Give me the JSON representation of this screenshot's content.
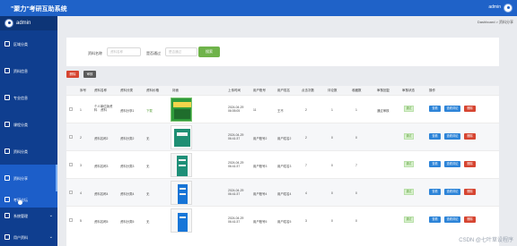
{
  "app": {
    "title": "\"聚力\"考研互助系统",
    "username": "admin"
  },
  "sidebar": {
    "profile_name": "admin",
    "items": [
      {
        "label": "区域分类",
        "icon": "grid-icon"
      },
      {
        "label": "资料信息",
        "icon": "book-icon"
      },
      {
        "label": "专业信息",
        "icon": "list-icon"
      },
      {
        "label": "课程分类",
        "icon": "folder-icon"
      },
      {
        "label": "资料分类",
        "icon": "category-icon"
      },
      {
        "label": "资料分享",
        "icon": "share-icon"
      },
      {
        "label": "考研论坛",
        "icon": "forum-icon"
      },
      {
        "label": "系统管理",
        "icon": "settings-icon"
      },
      {
        "label": "用户资料",
        "icon": "user-icon"
      }
    ]
  },
  "breadcrumb": "Dashboard > 资料分享",
  "search": {
    "label_name": "资料名称",
    "placeholder_name": "资料名称",
    "label_review": "是否通过",
    "placeholder_review": "是否通过",
    "button": "搜索"
  },
  "toolbar": {
    "delete": "删除",
    "export": "审核"
  },
  "table": {
    "headers": [
      "序号",
      "资料名称",
      "资料分类",
      "资料价格",
      "封面",
      "上传时间",
      "用户账号",
      "用户姓名",
      "点击次数",
      "评论数",
      "收藏数",
      "审核回复",
      "审核状态",
      "操作"
    ],
    "rows": [
      {
        "index": "1",
        "name": "个人单位版资料    资料",
        "category": "资料分享1",
        "price": "下载",
        "upload_time": "2024-04-29 06:05:05",
        "account": "11",
        "user_name": "王不",
        "clicks": "2",
        "comments": "1",
        "favorites": "1",
        "reply": "通过审核",
        "status": "通过"
      },
      {
        "index": "2",
        "name": "资料名称2",
        "category": "资料分类2",
        "price": "无",
        "upload_time": "2024-04-29 06:41:37",
        "account": "用户账号2",
        "user_name": "用户姓名2",
        "clicks": "2",
        "comments": "0",
        "favorites": "0",
        "reply": "",
        "status": "通过"
      },
      {
        "index": "3",
        "name": "资料名称3",
        "category": "资料分类3",
        "price": "无",
        "upload_time": "2024-04-29 06:41:37",
        "account": "用户账号3",
        "user_name": "用户姓名3",
        "clicks": "7",
        "comments": "0",
        "favorites": "7",
        "reply": "",
        "status": "通过"
      },
      {
        "index": "4",
        "name": "资料名称4",
        "category": "资料分类4",
        "price": "无",
        "upload_time": "2024-04-29 06:41:37",
        "account": "用户账号4",
        "user_name": "用户姓名4",
        "clicks": "4",
        "comments": "0",
        "favorites": "0",
        "reply": "",
        "status": "通过"
      },
      {
        "index": "5",
        "name": "资料名称5",
        "category": "资料分类5",
        "price": "无",
        "upload_time": "2024-04-29 06:41:37",
        "account": "用户账号5",
        "user_name": "用户姓名5",
        "clicks": "3",
        "comments": "0",
        "favorites": "0",
        "reply": "",
        "status": "通过"
      }
    ],
    "actions": {
      "view": "查看",
      "comments": "查看评论",
      "delete": "删除"
    }
  },
  "watermark": "CSDN @七叶草设程序",
  "colors": {
    "header": "#1f62c8",
    "sidebar": "#0f3e8f",
    "accent": "#1c5ec9",
    "danger": "#d64531",
    "success": "#6fb34a"
  }
}
